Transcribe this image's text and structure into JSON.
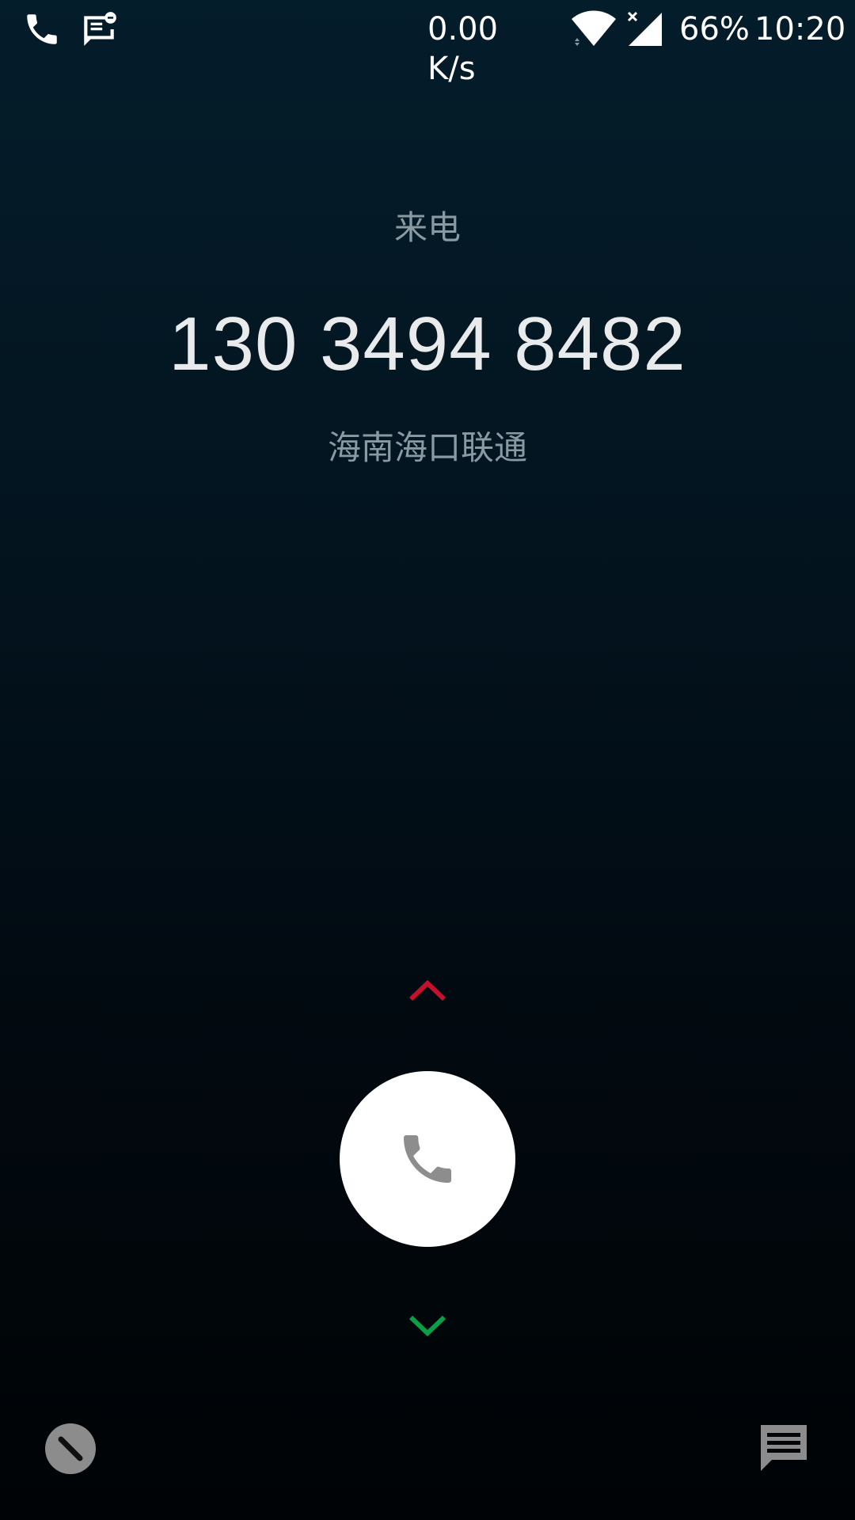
{
  "status_bar": {
    "left_icons": [
      "phone-icon",
      "message-notification-icon"
    ],
    "net_speed": "0.00 K/s",
    "wifi": "wifi-icon",
    "signal": "signal-icon",
    "battery": "66%",
    "time": "10:20"
  },
  "call": {
    "label": "来电",
    "number": "130 3494 8482",
    "location": "海南海口联通"
  },
  "controls": {
    "swipe_up_hint": "chevron-up-icon",
    "answer_icon": "phone-icon",
    "swipe_down_hint": "chevron-down-icon",
    "decline_icon": "block-icon",
    "message_icon": "message-icon"
  },
  "colors": {
    "background_top": "#041d2b",
    "background_bottom": "#000305",
    "decline_hint": "#c4102b",
    "answer_hint": "#0a9e45",
    "answer_button": "#ffffff",
    "answer_icon": "#8d8d8d",
    "secondary_text": "#8a9aa3"
  }
}
